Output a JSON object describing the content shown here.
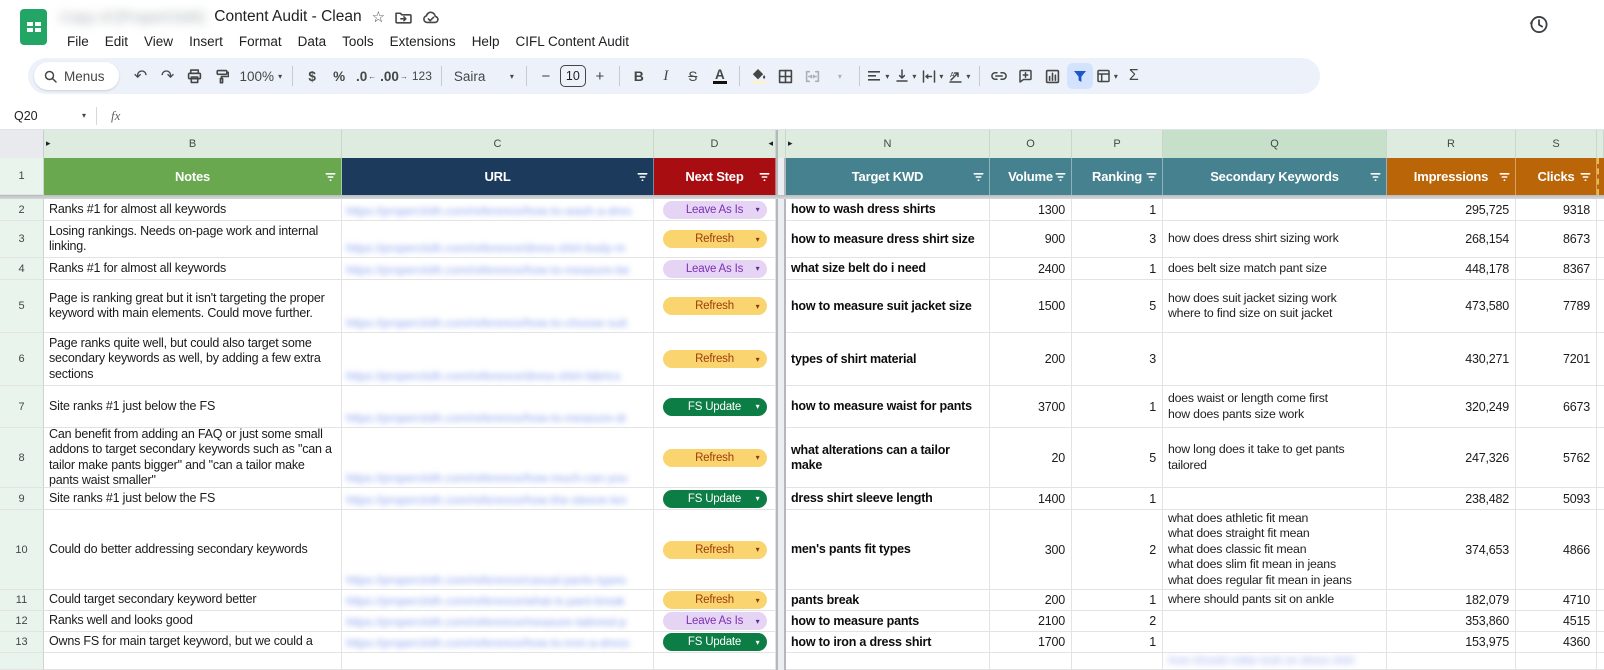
{
  "app": {
    "doc_title_redacted": "Copy of [ProperCloth]",
    "doc_title": "Content Audit - Clean",
    "menu": [
      "File",
      "Edit",
      "View",
      "Insert",
      "Format",
      "Data",
      "Tools",
      "Extensions",
      "Help",
      "CIFL Content Audit"
    ],
    "icons": {
      "logo": "sheets-logo",
      "star": "star-icon",
      "move": "move-folder-icon",
      "cloud": "cloud-saved-icon",
      "history": "version-history-icon"
    }
  },
  "toolbar": {
    "menus_label": "Menus",
    "zoom": "100%",
    "currency": "$",
    "percent": "%",
    "decrease_decimal": ".0",
    "increase_decimal": ".00",
    "format_123": "123",
    "font_name": "Saira",
    "font_size": "10",
    "minus": "−",
    "plus": "+",
    "bold": "B",
    "italic": "I",
    "strikethrough": "S",
    "text_color": "A",
    "sum": "Σ",
    "filter_active_bg": "#d3e3fd"
  },
  "formula_bar": {
    "name_box": "Q20",
    "fx_label": "fx"
  },
  "sheet": {
    "col_letters": [
      "B",
      "C",
      "D",
      "N",
      "O",
      "P",
      "Q",
      "R",
      "S"
    ],
    "header_row_num": "1",
    "headers": [
      {
        "label": "Notes",
        "color": "#6aa850"
      },
      {
        "label": "URL",
        "color": "#1c3a5c"
      },
      {
        "label": "Next Step",
        "color": "#a80d12"
      },
      {
        "label": "Target KWD",
        "color": "#45818e"
      },
      {
        "label": "Volume",
        "color": "#45818e"
      },
      {
        "label": "Ranking",
        "color": "#45818e"
      },
      {
        "label": "Secondary Keywords",
        "color": "#45818e"
      },
      {
        "label": "Impressions",
        "color": "#b96508"
      },
      {
        "label": "Clicks",
        "color": "#b96508"
      }
    ],
    "pill_colors": {
      "leave": {
        "bg": "#e6d4f4",
        "text": "#7a30b3"
      },
      "refresh": {
        "bg": "#fad46e",
        "text": "#9c3c0c"
      },
      "fs": {
        "bg": "#0c7d44",
        "text": "#ffffff"
      }
    },
    "rows": [
      {
        "num": "2",
        "note": "Ranks #1 for almost all keywords",
        "url": "https://propercloth.com/reference/how-to-wash-a-dres",
        "next": {
          "label": "Leave As Is",
          "style": "leave"
        },
        "target_kwd": "how to wash dress shirts",
        "volume": "1300",
        "ranking": "1",
        "secondary_keywords": [],
        "impressions": "295,725",
        "clicks": "9318"
      },
      {
        "num": "3",
        "note": "Losing rankings. Needs on-page work and internal linking.",
        "url": "https://propercloth.com/reference/dress-shirt-body-m",
        "next": {
          "label": "Refresh",
          "style": "refresh"
        },
        "target_kwd": "how to measure dress shirt size",
        "volume": "900",
        "ranking": "3",
        "secondary_keywords": [
          "how does dress shirt sizing work"
        ],
        "impressions": "268,154",
        "clicks": "8673"
      },
      {
        "num": "4",
        "note": "Ranks #1 for almost all keywords",
        "url": "https://propercloth.com/reference/how-to-measure-be",
        "next": {
          "label": "Leave As Is",
          "style": "leave"
        },
        "target_kwd": "what size belt do i need",
        "volume": "2400",
        "ranking": "1",
        "secondary_keywords": [
          "does belt size match pant size"
        ],
        "impressions": "448,178",
        "clicks": "8367"
      },
      {
        "num": "5",
        "note": "Page is ranking great but it isn't targeting the proper keyword with main elements. Could move further.",
        "url": "https://propercloth.com/reference/how-to-choose-suit",
        "next": {
          "label": "Refresh",
          "style": "refresh"
        },
        "target_kwd": "how to measure suit jacket size",
        "volume": "1500",
        "ranking": "5",
        "secondary_keywords": [
          "how does suit jacket sizing work",
          "where to find size on suit jacket"
        ],
        "impressions": "473,580",
        "clicks": "7789"
      },
      {
        "num": "6",
        "note": "Page ranks quite well, but could also target some secondary keywords as well, by adding a few extra sections",
        "url": "https://propercloth.com/reference/dress-shirt-fabrics",
        "next": {
          "label": "Refresh",
          "style": "refresh"
        },
        "target_kwd": "types of shirt material",
        "volume": "200",
        "ranking": "3",
        "secondary_keywords": [],
        "impressions": "430,271",
        "clicks": "7201"
      },
      {
        "num": "7",
        "note": "Site ranks #1 just below the FS",
        "url": "https://propercloth.com/reference/how-to-measure-dr",
        "next": {
          "label": "FS Update",
          "style": "fs"
        },
        "target_kwd": "how to measure waist for pants",
        "volume": "3700",
        "ranking": "1",
        "secondary_keywords": [
          "does waist or length come first",
          "how does pants size work"
        ],
        "impressions": "320,249",
        "clicks": "6673"
      },
      {
        "num": "8",
        "note": "Can benefit from adding an FAQ or just some small addons to target secondary keywords such as \"can a tailor make pants bigger\" and \"can a tailor make pants waist smaller\"",
        "url": "https://propercloth.com/reference/how-much-can-you",
        "next": {
          "label": "Refresh",
          "style": "refresh"
        },
        "target_kwd": "what alterations can a tailor make",
        "volume": "20",
        "ranking": "5",
        "secondary_keywords": [
          "how long does it take to get pants tailored"
        ],
        "impressions": "247,326",
        "clicks": "5762"
      },
      {
        "num": "9",
        "note": "Site ranks #1 just below the FS",
        "url": "https://propercloth.com/reference/how-the-sleeve-len",
        "next": {
          "label": "FS Update",
          "style": "fs"
        },
        "target_kwd": "dress shirt sleeve length",
        "volume": "1400",
        "ranking": "1",
        "secondary_keywords": [],
        "impressions": "238,482",
        "clicks": "5093"
      },
      {
        "num": "10",
        "note": "Could do better addressing secondary keywords",
        "url": "https://propercloth.com/reference/casual-pants-types",
        "next": {
          "label": "Refresh",
          "style": "refresh"
        },
        "target_kwd": "men's pants fit types",
        "volume": "300",
        "ranking": "2",
        "secondary_keywords": [
          "what does athletic fit mean",
          "what does straight fit mean",
          "what does classic fit mean",
          "what does slim fit mean in jeans",
          "what does regular fit mean in jeans"
        ],
        "impressions": "374,653",
        "clicks": "4866"
      },
      {
        "num": "11",
        "note": "Could target secondary keyword better",
        "url": "https://propercloth.com/reference/what-is-pant-break",
        "next": {
          "label": "Refresh",
          "style": "refresh"
        },
        "target_kwd": "pants break",
        "volume": "200",
        "ranking": "1",
        "secondary_keywords": [
          "where should pants sit on ankle"
        ],
        "impressions": "182,079",
        "clicks": "4710"
      },
      {
        "num": "12",
        "note": "Ranks well and looks good",
        "url": "https://propercloth.com/reference/measure-tailored-p",
        "next": {
          "label": "Leave As Is",
          "style": "leave"
        },
        "target_kwd": "how to measure pants",
        "volume": "2100",
        "ranking": "2",
        "secondary_keywords": [],
        "impressions": "353,860",
        "clicks": "4515"
      },
      {
        "num": "13",
        "note": "Owns FS for main target keyword, but we could a",
        "url": "https://propercloth.com/reference/how-to-iron-a-dress",
        "next": {
          "label": "FS Update",
          "style": "fs"
        },
        "target_kwd": "how to iron a dress shirt",
        "volume": "1700",
        "ranking": "1",
        "secondary_keywords": [],
        "impressions": "153,975",
        "clicks": "4360"
      }
    ],
    "partial_row": {
      "q_text": "how should collar look on dress shirt"
    }
  }
}
